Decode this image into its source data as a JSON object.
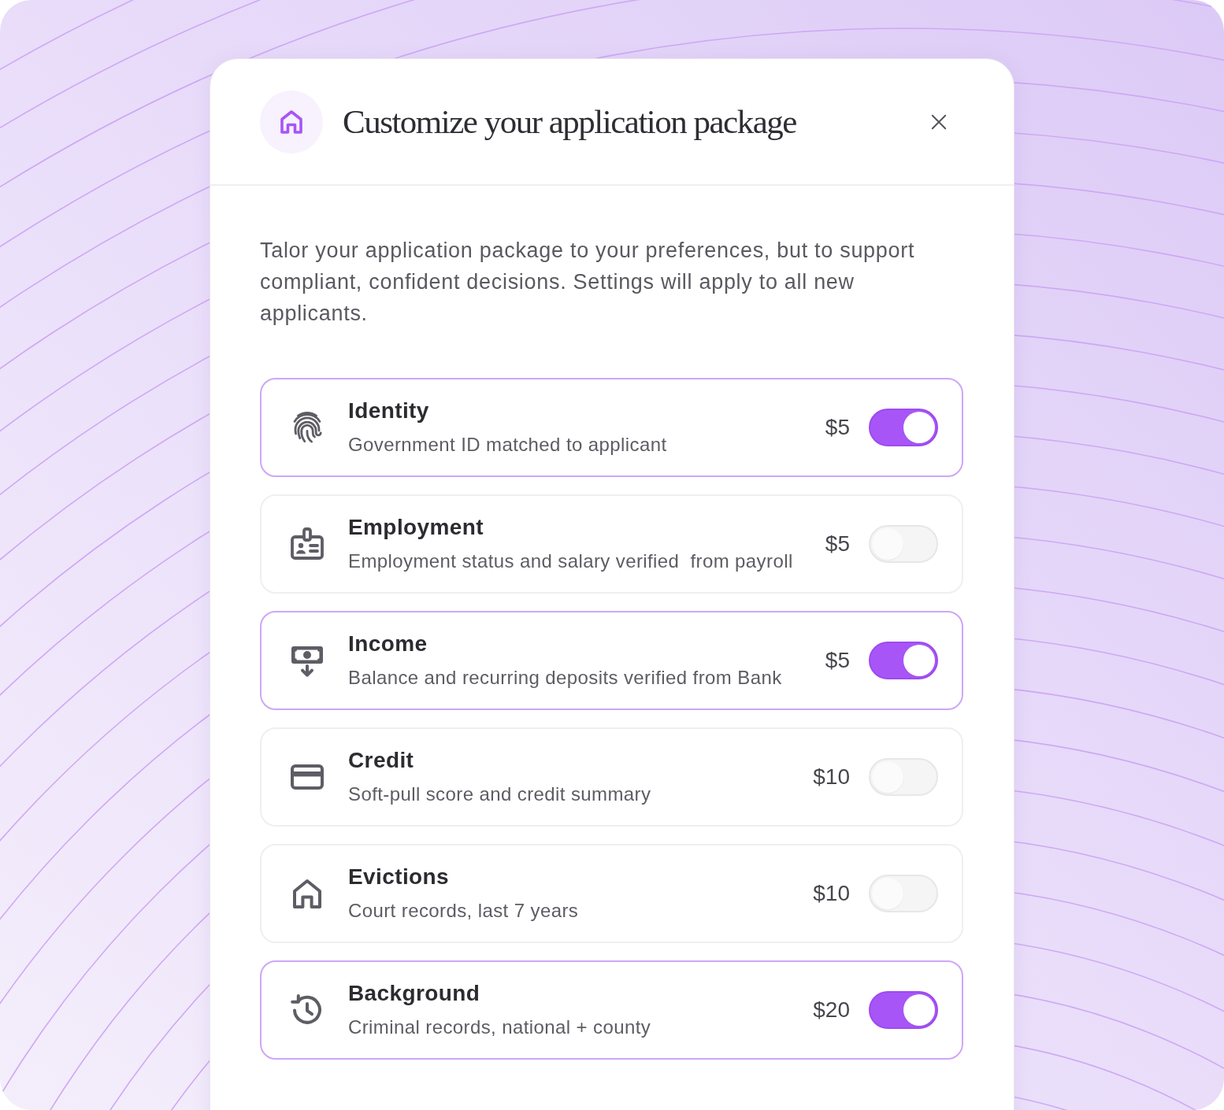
{
  "dialog": {
    "title": "Customize your application package",
    "intro": "Talor your application package to your preferences, but to support compliant, confident decisions. Settings will apply to all new applicants.",
    "options": [
      {
        "title": "Identity",
        "description": "Government ID matched to applicant",
        "price": "$5",
        "on": true
      },
      {
        "title": "Employment",
        "description": "Employment status and salary verified  from payroll",
        "price": "$5",
        "on": false
      },
      {
        "title": "Income",
        "description": "Balance and recurring deposits verified from Bank",
        "price": "$5",
        "on": true
      },
      {
        "title": "Credit",
        "description": "Soft-pull score and credit summary",
        "price": "$10",
        "on": false
      },
      {
        "title": "Evictions",
        "description": "Court records, last 7 years",
        "price": "$10",
        "on": false
      },
      {
        "title": "Background",
        "description": "Criminal records, national + county",
        "price": "$20",
        "on": true
      }
    ]
  }
}
